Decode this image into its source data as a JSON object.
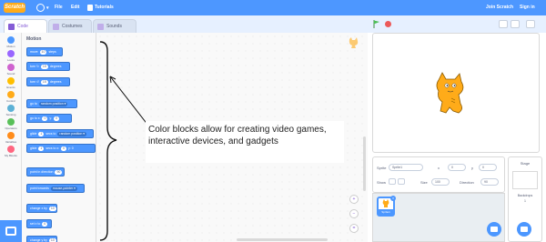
{
  "menu": {
    "logo": "Scratch",
    "file": "File",
    "edit": "Edit",
    "tutorials": "Tutorials",
    "join": "Join Scratch",
    "signin": "Sign in"
  },
  "tabs": [
    "Code",
    "Costumes",
    "Sounds"
  ],
  "categories": [
    {
      "label": "Motion",
      "color": "#4c97ff"
    },
    {
      "label": "Looks",
      "color": "#9966ff"
    },
    {
      "label": "Sound",
      "color": "#cf63cf"
    },
    {
      "label": "Events",
      "color": "#ffbf00"
    },
    {
      "label": "Control",
      "color": "#ffab19"
    },
    {
      "label": "Sensing",
      "color": "#5cb1d6"
    },
    {
      "label": "Operators",
      "color": "#59c059"
    },
    {
      "label": "Variables",
      "color": "#ff8c1a"
    },
    {
      "label": "My Blocks",
      "color": "#ff6680"
    }
  ],
  "palette": {
    "title": "Motion",
    "blocks": [
      {
        "pre": "move",
        "slot": "10",
        "post": "steps"
      },
      {
        "pre": "turn ↻",
        "slot": "15",
        "post": "degrees"
      },
      {
        "pre": "turn ↺",
        "slot": "15",
        "post": "degrees"
      },
      {
        "pre": "go to",
        "dd": "random position ▾"
      },
      {
        "pre": "go to x:",
        "slot": "0",
        "mid": "y:",
        "slot2": "0"
      },
      {
        "pre": "glide",
        "slot": "1",
        "mid": "secs to",
        "dd": "random position ▾"
      },
      {
        "pre": "glide",
        "slot": "1",
        "mid": "secs to x:",
        "slot2": "0",
        "post": "y: 0"
      },
      {
        "pre": "point in direction",
        "slot": "90"
      },
      {
        "pre": "point towards",
        "dd": "mouse-pointer ▾"
      },
      {
        "pre": "change x by",
        "slot": "10"
      },
      {
        "pre": "set x to",
        "slot": "0"
      },
      {
        "pre": "change y by",
        "slot": "10"
      }
    ]
  },
  "annotation": {
    "text": "Color blocks allow for creating video games, interactive devices, and gadgets"
  },
  "zoom": {
    "in": "+",
    "out": "−",
    "reset": "="
  },
  "sprite_info": {
    "sprite_label": "Sprite",
    "sprite_name": "Sprite1",
    "x_label": "x",
    "x_value": "0",
    "y_label": "y",
    "y_value": "0",
    "show_label": "Show",
    "size_label": "Size",
    "size_value": "100",
    "direction_label": "Direction",
    "direction_value": "90"
  },
  "sprite_list": {
    "thumb_label": "Sprite1"
  },
  "stage_panel": {
    "title": "Stage",
    "backdrops_label": "Backdrops",
    "backdrops_count": "1"
  }
}
